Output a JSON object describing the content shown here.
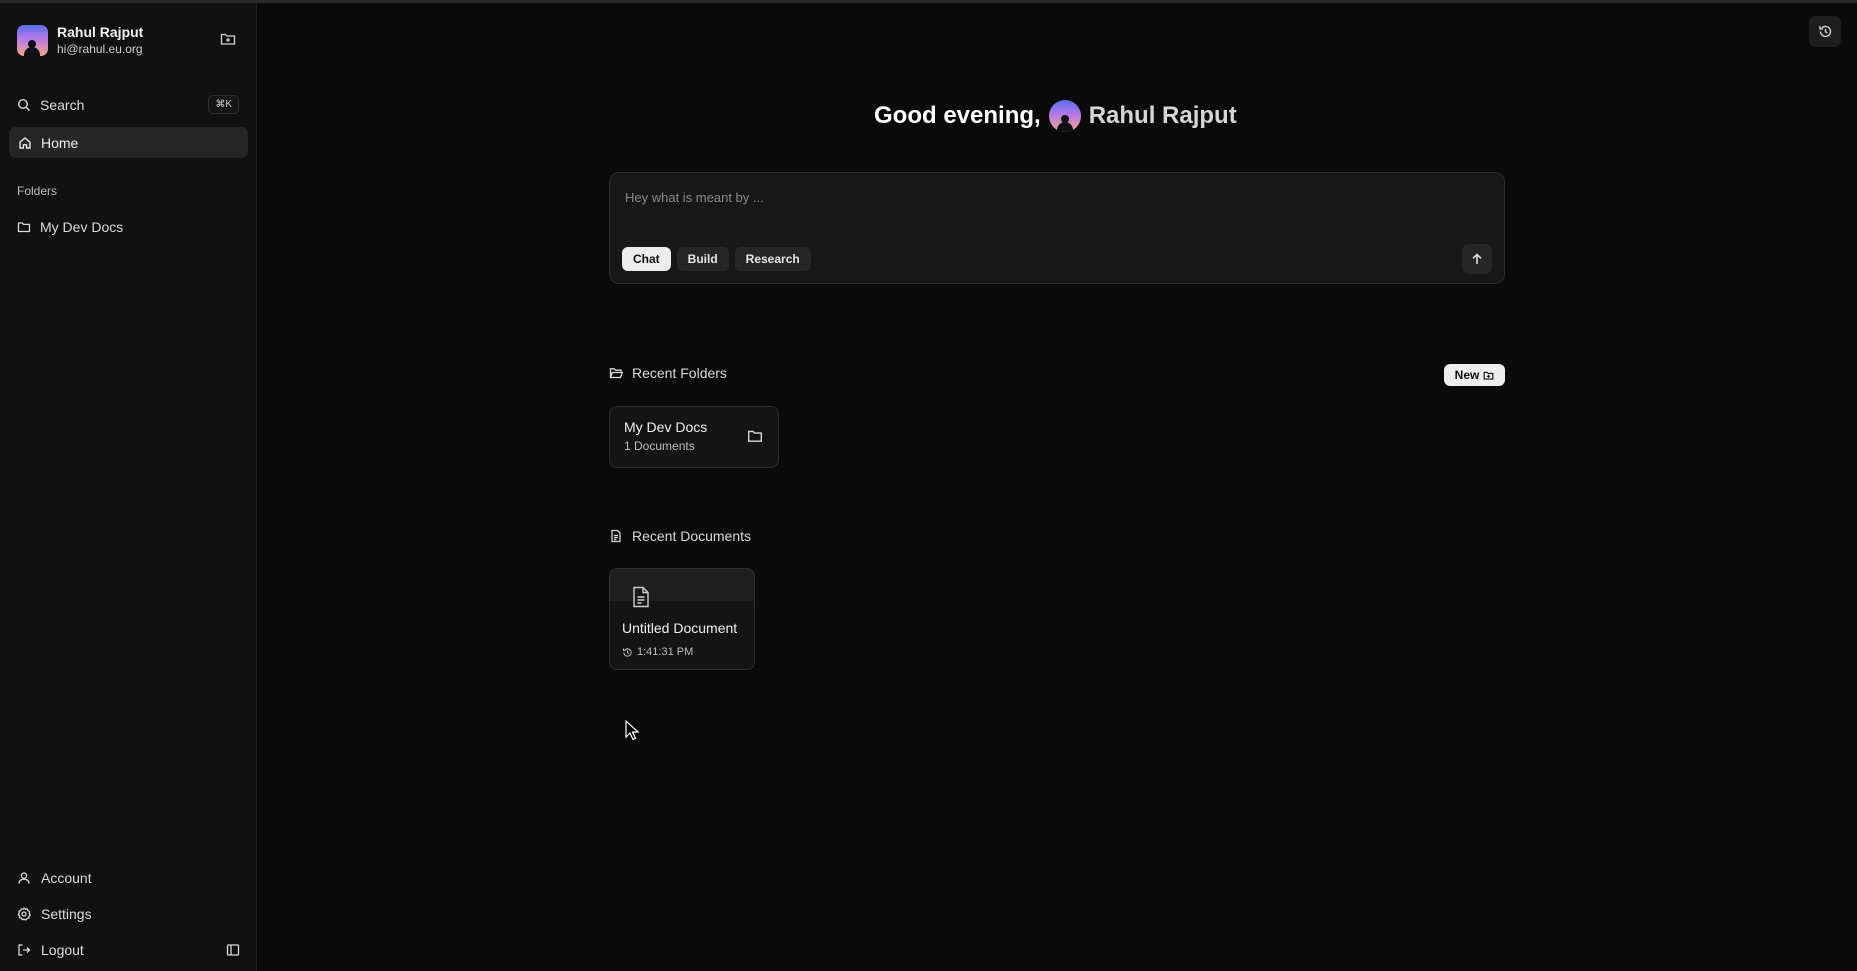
{
  "user": {
    "name": "Rahul Rajput",
    "email": "hi@rahul.eu.org"
  },
  "sidebar": {
    "search_label": "Search",
    "search_shortcut": "⌘K",
    "home_label": "Home",
    "folders_section": "Folders",
    "folders": [
      {
        "label": "My Dev Docs"
      }
    ],
    "bottom": {
      "account": "Account",
      "settings": "Settings",
      "logout": "Logout"
    }
  },
  "main": {
    "greeting": "Good evening,",
    "greeting_name": "Rahul Rajput",
    "composer": {
      "placeholder": "Hey what is meant by ...",
      "modes": [
        "Chat",
        "Build",
        "Research"
      ],
      "active_mode": "Chat"
    },
    "recent_folders": {
      "title": "Recent Folders",
      "new_label": "New",
      "items": [
        {
          "name": "My Dev Docs",
          "count": "1 Documents"
        }
      ]
    },
    "recent_documents": {
      "title": "Recent Documents",
      "items": [
        {
          "name": "Untitled Document",
          "time": "1:41:31 PM"
        }
      ]
    }
  },
  "colors": {
    "background": "#0a0a0a",
    "sidebar": "#111111",
    "accent_light": "#eeeeee"
  }
}
